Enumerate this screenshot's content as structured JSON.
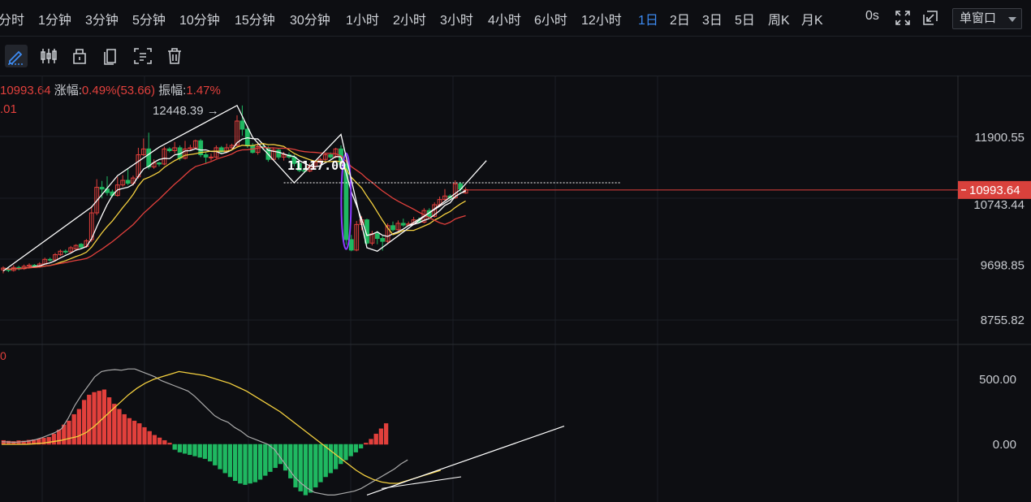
{
  "toolbar_top": {
    "intervals": [
      "分时",
      "1分钟",
      "3分钟",
      "5分钟",
      "10分钟",
      "15分钟",
      "30分钟",
      "1小时",
      "2小时",
      "3小时",
      "4小时",
      "6小时",
      "12小时",
      "1日",
      "2日",
      "3日",
      "5日",
      "周K",
      "月K"
    ],
    "active_interval": "1日",
    "timer": "0s",
    "window_mode": "单窗口",
    "icons": [
      "fullscreen-icon",
      "popout-window-icon"
    ]
  },
  "drawing_tools": [
    "pencil-icon",
    "candlestick-icon",
    "cube-icon",
    "copy-icon",
    "screenshot-icon",
    "trash-icon"
  ],
  "info": {
    "price_fragment": "10993.64",
    "change_label": "涨幅:",
    "change_value": "0.49%(53.66)",
    "amplitude_label": "振幅:",
    "amplitude_value": "1.47%",
    "sub_fragment": ".01",
    "macd_fragment": "0"
  },
  "colors": {
    "up": "#e2403c",
    "down": "#1fb861",
    "ma_fast": "#ffffff",
    "ma_mid": "#f4d03f",
    "ma_slow": "#e2403c",
    "macd_dif": "#aaaaaa",
    "macd_dea": "#f4d03f",
    "ellipse": "#8a3cff"
  },
  "chart_data": {
    "type": "candlestick",
    "price_axis": {
      "ticks": [
        11900.55,
        10743.44,
        9698.85,
        8755.82
      ],
      "min": 8050,
      "max": 12750
    },
    "current_price_label": "10993.64",
    "high_annotation": "12448.39",
    "level_annotation": "11117.00",
    "candles": [
      [
        9620,
        9650,
        9560,
        9680
      ],
      [
        9630,
        9610,
        9580,
        9660
      ],
      [
        9610,
        9660,
        9590,
        9700
      ],
      [
        9660,
        9640,
        9610,
        9690
      ],
      [
        9640,
        9680,
        9620,
        9710
      ],
      [
        9680,
        9700,
        9650,
        9730
      ],
      [
        9700,
        9690,
        9660,
        9720
      ],
      [
        9690,
        9720,
        9670,
        9750
      ],
      [
        9720,
        9800,
        9700,
        9830
      ],
      [
        9800,
        9790,
        9760,
        9830
      ],
      [
        9790,
        9880,
        9770,
        9910
      ],
      [
        9880,
        9940,
        9860,
        9970
      ],
      [
        9940,
        9930,
        9890,
        9970
      ],
      [
        9930,
        10000,
        9910,
        10030
      ],
      [
        9980,
        10040,
        9950,
        10060
      ],
      [
        10060,
        10010,
        9980,
        10080
      ],
      [
        10020,
        10120,
        10000,
        10150
      ],
      [
        10140,
        10600,
        10100,
        10720
      ],
      [
        10600,
        11040,
        10560,
        11180
      ],
      [
        11040,
        11010,
        10850,
        11150
      ],
      [
        11010,
        10950,
        10900,
        11230
      ],
      [
        10960,
        10900,
        10870,
        11000
      ],
      [
        10900,
        11080,
        10880,
        11220
      ],
      [
        11080,
        11160,
        11050,
        11250
      ],
      [
        11160,
        11110,
        11080,
        11350
      ],
      [
        11110,
        11200,
        11070,
        11240
      ],
      [
        11220,
        11600,
        11190,
        11720
      ],
      [
        11600,
        11700,
        11580,
        11880
      ],
      [
        11700,
        11390,
        11350,
        11980
      ],
      [
        11390,
        11460,
        11360,
        11520
      ],
      [
        11460,
        11440,
        11400,
        11480
      ],
      [
        11440,
        11700,
        11420,
        11740
      ],
      [
        11700,
        11670,
        11640,
        11730
      ],
      [
        11670,
        11720,
        11620,
        11820
      ],
      [
        11720,
        11540,
        11500,
        11760
      ],
      [
        11540,
        11700,
        11520,
        11840
      ],
      [
        11700,
        11720,
        11680,
        11770
      ],
      [
        11720,
        11840,
        11700,
        11860
      ],
      [
        11840,
        11600,
        11560,
        11870
      ],
      [
        11600,
        11560,
        11450,
        11640
      ],
      [
        11560,
        11560,
        11500,
        11620
      ],
      [
        11560,
        11720,
        11540,
        11760
      ],
      [
        11720,
        11650,
        11620,
        11750
      ],
      [
        11650,
        11720,
        11630,
        11790
      ],
      [
        11720,
        11760,
        11690,
        11790
      ],
      [
        11760,
        12180,
        11740,
        12280
      ],
      [
        12180,
        12040,
        11930,
        12448
      ],
      [
        12040,
        11760,
        11720,
        12080
      ],
      [
        11760,
        11640,
        11620,
        11800
      ],
      [
        11640,
        11740,
        11600,
        11820
      ],
      [
        11740,
        11720,
        11680,
        11770
      ],
      [
        11720,
        11520,
        11480,
        11750
      ],
      [
        11520,
        11680,
        11500,
        11720
      ],
      [
        11680,
        11560,
        11520,
        11700
      ],
      [
        11560,
        11600,
        11500,
        11650
      ],
      [
        11600,
        11560,
        11530,
        11640
      ],
      [
        11560,
        11450,
        11400,
        11600
      ],
      [
        11450,
        11330,
        11300,
        11470
      ],
      [
        11330,
        11320,
        11290,
        11380
      ],
      [
        11320,
        11400,
        11300,
        11450
      ],
      [
        11400,
        11470,
        11370,
        11500
      ],
      [
        11470,
        11520,
        11440,
        11550
      ],
      [
        11520,
        11600,
        11490,
        11620
      ],
      [
        11600,
        11560,
        11530,
        11640
      ],
      [
        11560,
        11700,
        11540,
        11720
      ],
      [
        11700,
        11440,
        11400,
        11760
      ],
      [
        11440,
        10140,
        10050,
        11480
      ],
      [
        10140,
        9960,
        9940,
        10220
      ],
      [
        9960,
        10400,
        9940,
        10460
      ],
      [
        10400,
        10480,
        10300,
        10540
      ],
      [
        10480,
        10080,
        10050,
        10500
      ],
      [
        10080,
        10240,
        10040,
        10290
      ],
      [
        10240,
        10160,
        10060,
        10290
      ],
      [
        10160,
        10110,
        9950,
        10200
      ],
      [
        10110,
        10380,
        10080,
        10420
      ],
      [
        10380,
        10310,
        10280,
        10450
      ],
      [
        10310,
        10420,
        10290,
        10470
      ],
      [
        10420,
        10390,
        10360,
        10500
      ],
      [
        10390,
        10410,
        10380,
        10450
      ],
      [
        10410,
        10480,
        10390,
        10530
      ],
      [
        10480,
        10440,
        10420,
        10520
      ],
      [
        10440,
        10640,
        10420,
        10680
      ],
      [
        10640,
        10540,
        10500,
        10680
      ],
      [
        10540,
        10740,
        10520,
        10780
      ],
      [
        10740,
        10830,
        10700,
        10880
      ],
      [
        10830,
        10890,
        10800,
        11010
      ],
      [
        10890,
        10860,
        10820,
        10920
      ],
      [
        10860,
        11100,
        10840,
        11160
      ],
      [
        11100,
        11010,
        10960,
        11130
      ],
      [
        10940,
        11000,
        10930,
        11040
      ]
    ],
    "macd_axis": {
      "ticks": [
        500.0,
        0.0
      ],
      "min": -420,
      "max": 620
    },
    "macd_hist": [
      30,
      25,
      22,
      28,
      26,
      32,
      36,
      42,
      48,
      55,
      80,
      110,
      150,
      180,
      230,
      270,
      340,
      380,
      400,
      410,
      420,
      360,
      310,
      270,
      230,
      200,
      180,
      160,
      130,
      100,
      70,
      50,
      30,
      10,
      -40,
      -60,
      -70,
      -80,
      -90,
      -100,
      -110,
      -130,
      -160,
      -190,
      -220,
      -250,
      -280,
      -300,
      -310,
      -300,
      -290,
      -270,
      -240,
      -210,
      -180,
      -150,
      -200,
      -260,
      -330,
      -360,
      -390,
      -370,
      -330,
      -290,
      -250,
      -220,
      -190,
      -150,
      -120,
      -90,
      -60,
      -30,
      10,
      40,
      80,
      120,
      160
    ],
    "macd_dif": [
      20,
      18,
      16,
      20,
      25,
      35,
      50,
      70,
      90,
      120,
      200,
      300,
      380,
      450,
      520,
      560,
      570,
      575,
      570,
      580,
      580,
      560,
      540,
      520,
      490,
      470,
      450,
      430,
      410,
      370,
      320,
      270,
      220,
      190,
      170,
      130,
      100,
      60,
      40,
      20,
      0,
      -40,
      -110,
      -180,
      -250,
      -300,
      -340,
      -370,
      -380,
      -390,
      -390,
      -380,
      -370,
      -360,
      -340,
      -310,
      -280,
      -250,
      -220,
      -190,
      -150,
      -120
    ],
    "macd_dea": [
      0,
      0,
      0,
      0,
      5,
      10,
      20,
      30,
      45,
      60,
      90,
      140,
      200,
      260,
      320,
      380,
      430,
      470,
      500,
      520,
      540,
      560,
      550,
      540,
      530,
      510,
      490,
      470,
      440,
      410,
      370,
      330,
      290,
      250,
      200,
      150,
      100,
      50,
      0,
      -50,
      -100,
      -150,
      -200,
      -240,
      -270,
      -290,
      -300,
      -300,
      -280,
      -260,
      -240,
      -220,
      -200
    ]
  }
}
